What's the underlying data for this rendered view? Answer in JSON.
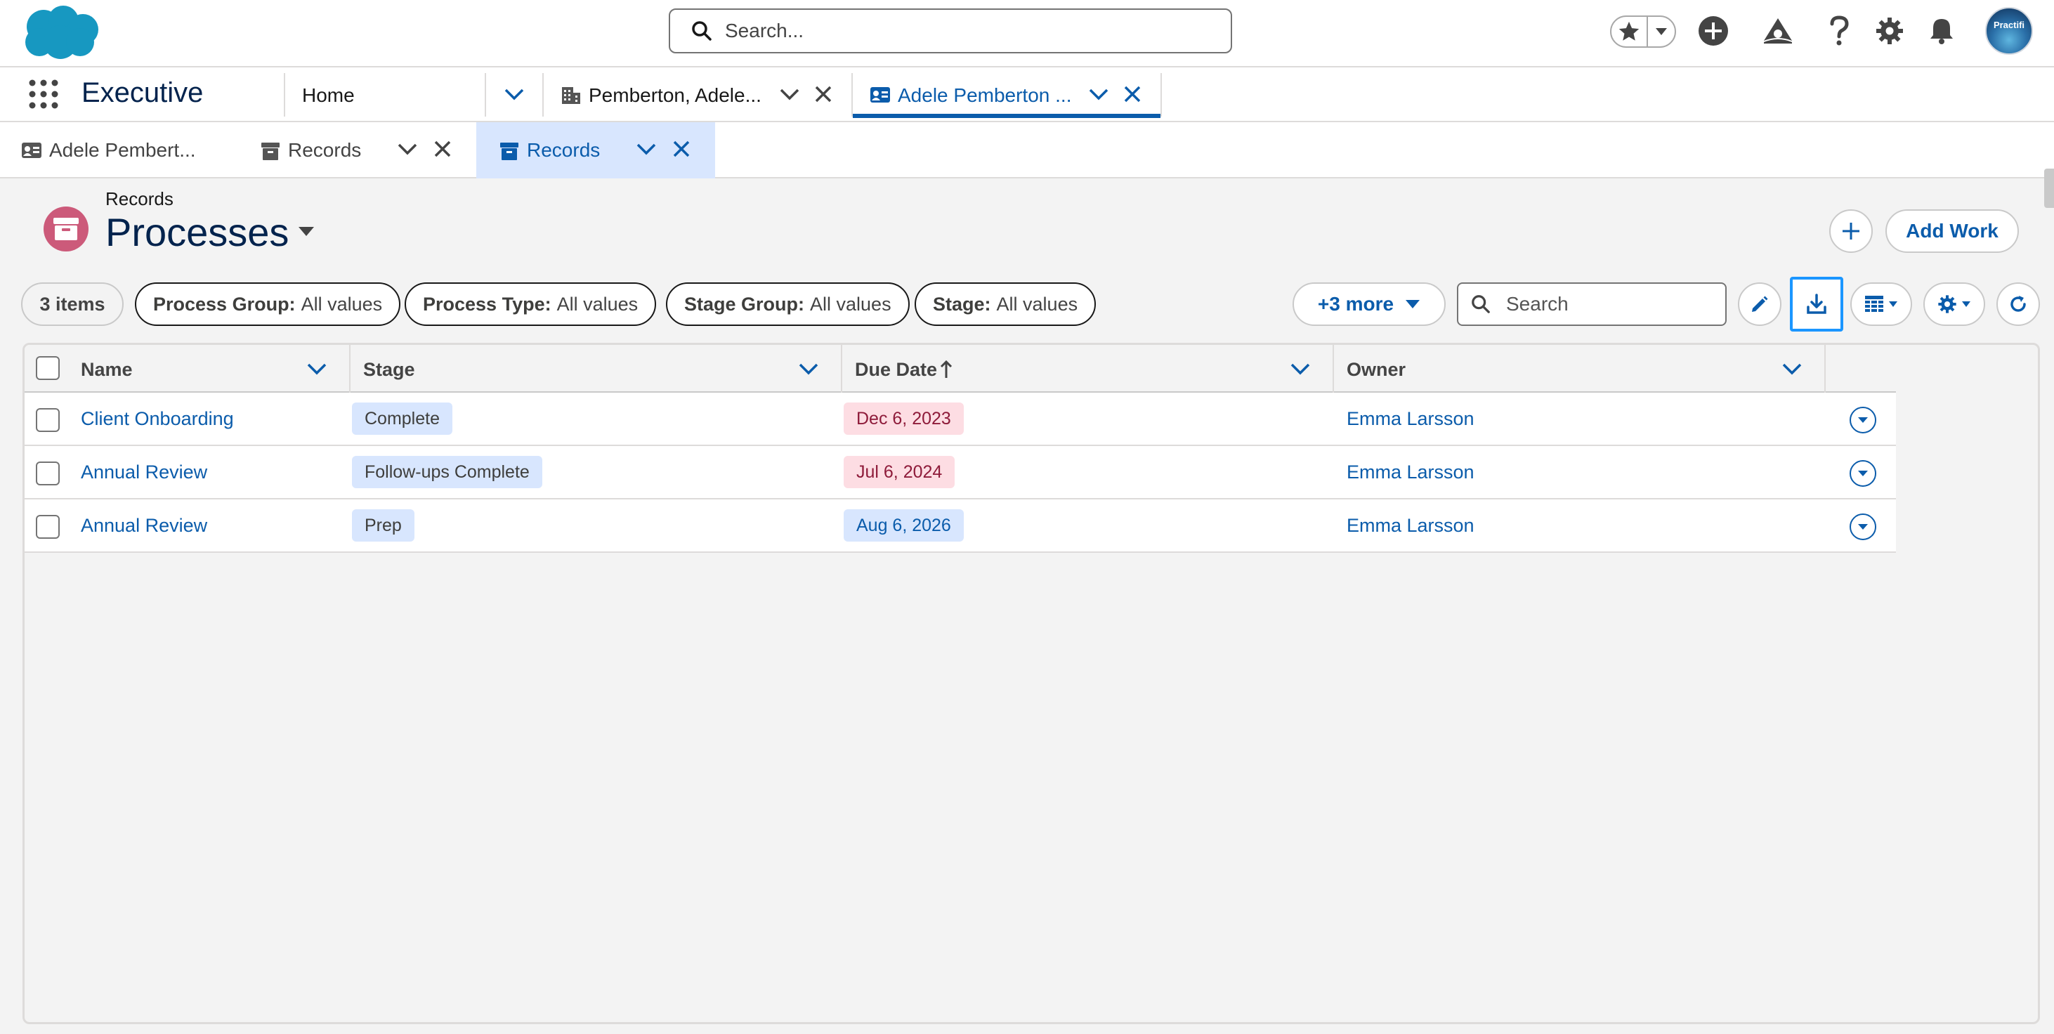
{
  "global_header": {
    "search_placeholder": "Search...",
    "avatar_text": "Practifi"
  },
  "nav": {
    "app_name": "Executive",
    "home_label": "Home",
    "tabs": [
      {
        "label": "Pemberton, Adele..."
      },
      {
        "label": "Adele Pemberton ..."
      }
    ]
  },
  "subtabs": [
    {
      "label": "Adele Pembert..."
    },
    {
      "label": "Records"
    },
    {
      "label": "Records"
    }
  ],
  "page": {
    "breadcrumb": "Records",
    "title": "Processes",
    "add_work_label": "Add Work"
  },
  "filters": {
    "count": "3 items",
    "items": [
      {
        "name": "Process Group:",
        "value": "All values"
      },
      {
        "name": "Process Type:",
        "value": "All values"
      },
      {
        "name": "Stage Group:",
        "value": "All values"
      },
      {
        "name": "Stage:",
        "value": "All values"
      }
    ],
    "more_label": "+3 more",
    "search_placeholder": "Search"
  },
  "table": {
    "columns": [
      "Name",
      "Stage",
      "Due Date",
      "Owner"
    ],
    "sort_column": "Due Date",
    "sort_direction": "ascending",
    "rows": [
      {
        "name": "Client Onboarding",
        "stage": "Complete",
        "due_date": "Dec 6, 2023",
        "due_status": "overdue",
        "owner": "Emma Larsson"
      },
      {
        "name": "Annual Review",
        "stage": "Follow-ups Complete",
        "due_date": "Jul 6, 2024",
        "due_status": "overdue",
        "owner": "Emma Larsson"
      },
      {
        "name": "Annual Review",
        "stage": "Prep",
        "due_date": "Aug 6, 2026",
        "due_status": "upcoming",
        "owner": "Emma Larsson"
      }
    ]
  },
  "colors": {
    "brand_blue": "#0b5cab",
    "object_icon": "#cc5a7a",
    "overdue_badge": "#fddde3",
    "upcoming_badge": "#d8e6fe",
    "active_subtab": "#d8e6fe",
    "focus_ring": "#1b96ff"
  },
  "icons": [
    "salesforce-cloud-logo",
    "search-icon",
    "star-icon",
    "chevron-down-icon",
    "plus-circle-icon",
    "trailhead-icon",
    "help-icon",
    "gear-icon",
    "bell-icon",
    "app-launcher-icon",
    "account-icon",
    "contact-card-icon",
    "records-icon",
    "close-icon",
    "pencil-icon",
    "download-icon",
    "table-icon",
    "refresh-icon",
    "sort-up-arrow-icon"
  ]
}
